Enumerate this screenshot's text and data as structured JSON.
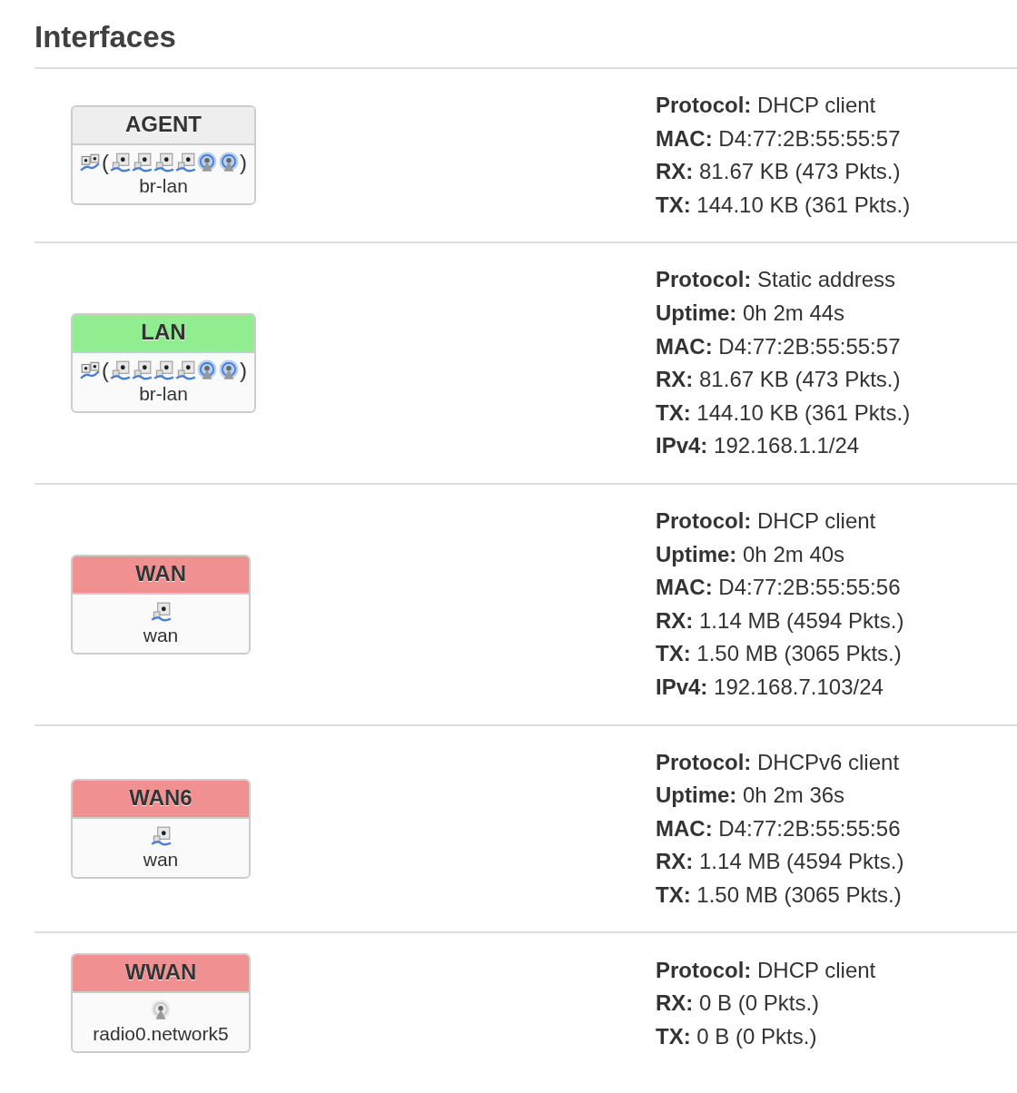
{
  "title": "Interfaces",
  "interfaces": [
    {
      "name": "AGENT",
      "color": "#eeeeee",
      "main": [
        {
          "kind": "bridge"
        }
      ],
      "open": "(",
      "members": [
        {
          "kind": "ethernet"
        },
        {
          "kind": "ethernet"
        },
        {
          "kind": "ethernet"
        },
        {
          "kind": "ethernet"
        },
        {
          "kind": "wifi"
        },
        {
          "kind": "wifi"
        }
      ],
      "close": ")",
      "device": "br-lan",
      "details": [
        {
          "label": "Protocol:",
          "value": "DHCP client"
        },
        {
          "label": "MAC:",
          "value": "D4:77:2B:55:55:57"
        },
        {
          "label": "RX:",
          "value": "81.67 KB (473 Pkts.)"
        },
        {
          "label": "TX:",
          "value": "144.10 KB (361 Pkts.)"
        }
      ]
    },
    {
      "name": "LAN",
      "color": "#90ee90",
      "main": [
        {
          "kind": "bridge"
        }
      ],
      "open": "(",
      "members": [
        {
          "kind": "ethernet"
        },
        {
          "kind": "ethernet"
        },
        {
          "kind": "ethernet"
        },
        {
          "kind": "ethernet"
        },
        {
          "kind": "wifi"
        },
        {
          "kind": "wifi"
        }
      ],
      "close": ")",
      "device": "br-lan",
      "details": [
        {
          "label": "Protocol:",
          "value": "Static address"
        },
        {
          "label": "Uptime:",
          "value": "0h 2m 44s"
        },
        {
          "label": "MAC:",
          "value": "D4:77:2B:55:55:57"
        },
        {
          "label": "RX:",
          "value": "81.67 KB (473 Pkts.)"
        },
        {
          "label": "TX:",
          "value": "144.10 KB (361 Pkts.)"
        },
        {
          "label": "IPv4:",
          "value": "192.168.1.1/24"
        }
      ]
    },
    {
      "name": "WAN",
      "color": "#f09090",
      "main": [
        {
          "kind": "ethernet"
        }
      ],
      "device": "wan",
      "details": [
        {
          "label": "Protocol:",
          "value": "DHCP client"
        },
        {
          "label": "Uptime:",
          "value": "0h 2m 40s"
        },
        {
          "label": "MAC:",
          "value": "D4:77:2B:55:55:56"
        },
        {
          "label": "RX:",
          "value": "1.14 MB (4594 Pkts.)"
        },
        {
          "label": "TX:",
          "value": "1.50 MB (3065 Pkts.)"
        },
        {
          "label": "IPv4:",
          "value": "192.168.7.103/24"
        }
      ]
    },
    {
      "name": "WAN6",
      "color": "#f09090",
      "main": [
        {
          "kind": "ethernet"
        }
      ],
      "device": "wan",
      "details": [
        {
          "label": "Protocol:",
          "value": "DHCPv6 client"
        },
        {
          "label": "Uptime:",
          "value": "0h 2m 36s"
        },
        {
          "label": "MAC:",
          "value": "D4:77:2B:55:55:56"
        },
        {
          "label": "RX:",
          "value": "1.14 MB (4594 Pkts.)"
        },
        {
          "label": "TX:",
          "value": "1.50 MB (3065 Pkts.)"
        }
      ]
    },
    {
      "name": "WWAN",
      "color": "#f09090",
      "main": [
        {
          "kind": "wifi-off"
        }
      ],
      "device": "radio0.network5",
      "details": [
        {
          "label": "Protocol:",
          "value": "DHCP client"
        },
        {
          "label": "RX:",
          "value": "0 B (0 Pkts.)"
        },
        {
          "label": "TX:",
          "value": "0 B (0 Pkts.)"
        }
      ]
    }
  ]
}
